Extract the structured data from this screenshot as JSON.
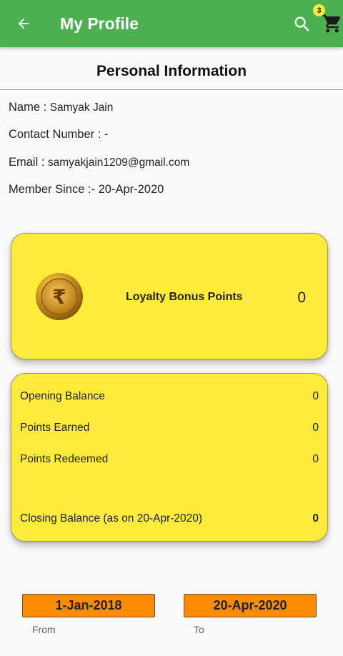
{
  "appbar": {
    "title": "My Profile",
    "cart_count": "3",
    "brand_color": "#4caf50",
    "icons": [
      "back-arrow-icon",
      "search-icon",
      "cart-icon"
    ]
  },
  "personal": {
    "title": "Personal Information",
    "name_label": "Name :",
    "name_value": "Samyak Jain",
    "contact_label": "Contact Number : -",
    "email_label": "Email :",
    "email_value": "samyakjain1209@gmail.com",
    "member_label": "Member Since :- 20-Apr-2020"
  },
  "loyalty": {
    "label": "Loyalty Bonus Points",
    "value": "0",
    "card_color": "#ffeb3b"
  },
  "balance": {
    "rows": [
      {
        "label": "Opening Balance",
        "value": "0"
      },
      {
        "label": "Points Earned",
        "value": "0"
      },
      {
        "label": "Points Redeemed",
        "value": "0"
      }
    ],
    "closing_label": "Closing Balance (as on 20-Apr-2020)",
    "closing_value": "0"
  },
  "dates": {
    "from_value": "1-Jan-2018",
    "from_caption": "From",
    "to_value": "20-Apr-2020",
    "to_caption": "To",
    "button_color": "#fb8c00"
  }
}
